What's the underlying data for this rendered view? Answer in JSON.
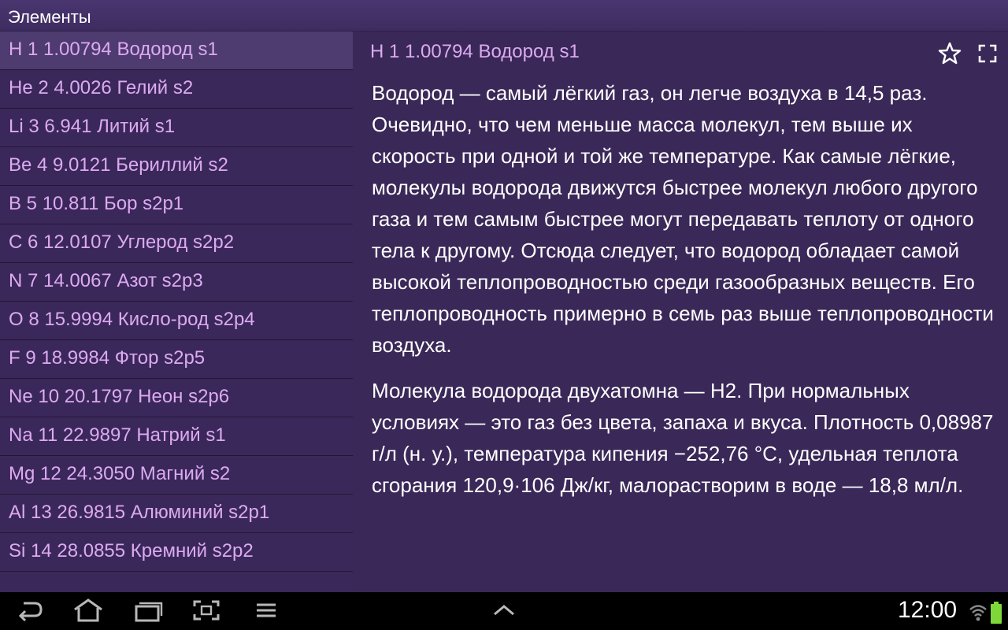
{
  "app": {
    "title": "Элементы"
  },
  "sidebar": {
    "items": [
      {
        "label": "H 1 1.00794 Водород s1"
      },
      {
        "label": "He 2 4.0026 Гелий s2"
      },
      {
        "label": "Li 3 6.941 Литий s1"
      },
      {
        "label": "Be 4 9.0121 Бериллий s2"
      },
      {
        "label": "B 5 10.811 Бор s2p1"
      },
      {
        "label": "C 6 12.0107 Углерод s2p2"
      },
      {
        "label": "N 7 14.0067 Азот s2p3"
      },
      {
        "label": "O 8 15.9994 Кисло-род s2p4"
      },
      {
        "label": "F 9 18.9984 Фтор s2p5"
      },
      {
        "label": "Ne 10 20.1797 Неон s2p6"
      },
      {
        "label": "Na 11 22.9897 Натрий s1"
      },
      {
        "label": "Mg 12 24.3050 Магний s2"
      },
      {
        "label": "Al 13 26.9815 Алюминий s2p1"
      },
      {
        "label": "Si 14 28.0855 Кремний s2p2"
      }
    ],
    "selected_index": 0
  },
  "content": {
    "header": "H 1 1.00794 Водород s1",
    "star_icon": "star-outline-icon",
    "fullscreen_icon": "fullscreen-icon",
    "paragraphs": [
      "Водород — самый лёгкий газ, он легче воздуха в 14,5 раз. Очевидно, что чем меньше масса молекул, тем выше их скорость при одной и той же температуре. Как самые лёгкие, молекулы водорода движутся быстрее молекул любого другого газа и тем самым быстрее могут передавать теплоту от одного тела к другому. Отсюда следует, что водород обладает самой высокой теплопроводностью среди газообразных веществ. Его теплопроводность примерно в семь раз выше теплопроводности воздуха.",
      "Молекула водорода двухатомна — H2. При нормальных условиях — это газ без цвета, запаха и вкуса. Плотность 0,08987 г/л (н. у.), температура кипения −252,76 °C, удельная теплота сгорания 120,9·106 Дж/кг, малорастворим в воде — 18,8 мл/л."
    ]
  },
  "navbar": {
    "buttons": [
      "back-icon",
      "home-icon",
      "recent-apps-icon",
      "screenshot-icon",
      "menu-icon",
      "chevron-up-icon"
    ],
    "clock": "12:00",
    "wifi_icon": "wifi-icon",
    "battery_icon": "battery-icon"
  },
  "colors": {
    "background": "#3a2858",
    "item_text": "#dcaaf0",
    "selected_item": "#4e3b70",
    "body_text": "#ffffff",
    "navbar": "#000000",
    "battery": "#7fd83a"
  }
}
